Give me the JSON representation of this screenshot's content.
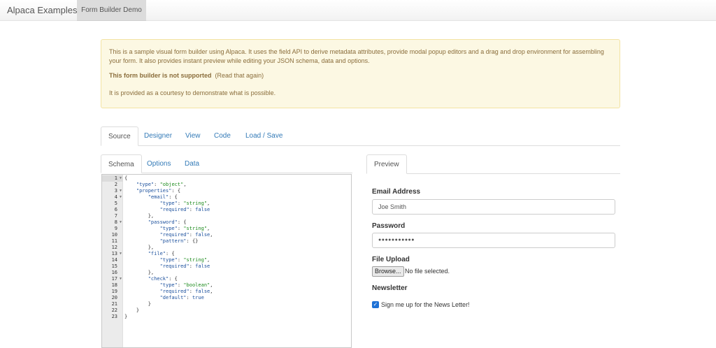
{
  "navbar": {
    "brand": "Alpaca Examples",
    "active_tab": "Form Builder Demo"
  },
  "alert": {
    "intro": "This is a sample visual form builder using Alpaca. It uses the field API to derive metadata attributes, provide modal popup editors and a drag and drop environment for assembling your form. It also provides instant preview while editing your JSON schema, data and options.",
    "warning_bold": "This form builder is not supported",
    "warning_note": "(Read that again)",
    "courtesy": "It is provided as a courtesy to demonstrate what is possible."
  },
  "main_tabs": {
    "source": "Source",
    "designer": "Designer",
    "view": "View",
    "code": "Code",
    "load_save": "Load / Save",
    "active": "Source"
  },
  "sub_tabs": {
    "schema": "Schema",
    "options": "Options",
    "data": "Data",
    "active": "Schema"
  },
  "editor": {
    "current_line": 1,
    "lines": [
      {
        "n": "1",
        "fold": true,
        "text": "{"
      },
      {
        "n": "2",
        "fold": false,
        "text": "    \"type\": \"object\","
      },
      {
        "n": "3",
        "fold": true,
        "text": "    \"properties\": {"
      },
      {
        "n": "4",
        "fold": true,
        "text": "        \"email\": {"
      },
      {
        "n": "5",
        "fold": false,
        "text": "            \"type\": \"string\","
      },
      {
        "n": "6",
        "fold": false,
        "text": "            \"required\": false"
      },
      {
        "n": "7",
        "fold": false,
        "text": "        },"
      },
      {
        "n": "8",
        "fold": true,
        "text": "        \"password\": {"
      },
      {
        "n": "9",
        "fold": false,
        "text": "            \"type\": \"string\","
      },
      {
        "n": "10",
        "fold": false,
        "text": "            \"required\": false,"
      },
      {
        "n": "11",
        "fold": false,
        "text": "            \"pattern\": {}"
      },
      {
        "n": "12",
        "fold": false,
        "text": "        },"
      },
      {
        "n": "13",
        "fold": true,
        "text": "        \"file\": {"
      },
      {
        "n": "14",
        "fold": false,
        "text": "            \"type\": \"string\","
      },
      {
        "n": "15",
        "fold": false,
        "text": "            \"required\": false"
      },
      {
        "n": "16",
        "fold": false,
        "text": "        },"
      },
      {
        "n": "17",
        "fold": true,
        "text": "        \"check\": {"
      },
      {
        "n": "18",
        "fold": false,
        "text": "            \"type\": \"boolean\","
      },
      {
        "n": "19",
        "fold": false,
        "text": "            \"required\": false,"
      },
      {
        "n": "20",
        "fold": false,
        "text": "            \"default\": true"
      },
      {
        "n": "21",
        "fold": false,
        "text": "        }"
      },
      {
        "n": "22",
        "fold": false,
        "text": "    }"
      },
      {
        "n": "23",
        "fold": false,
        "text": "}"
      }
    ]
  },
  "preview": {
    "tab": "Preview",
    "email_label": "Email Address",
    "email_value": "Joe Smith",
    "password_label": "Password",
    "password_value": "●●●●●●●●●●●",
    "file_label": "File Upload",
    "browse_label": "Browse...",
    "no_file": "No file selected.",
    "newsletter_label": "Newsletter",
    "newsletter_option": "Sign me up for the News Letter!",
    "newsletter_checked": true
  },
  "colors": {
    "link": "#337ab7",
    "alert_bg": "#fcf8e3",
    "alert_text": "#8a6d3b",
    "json_key": "#1a4f9c",
    "json_string": "#1b8a1b",
    "checkbox": "#1f72d6"
  },
  "icons": {
    "fold_marker": "fold-arrow-icon",
    "checkbox_check": "check-icon"
  }
}
